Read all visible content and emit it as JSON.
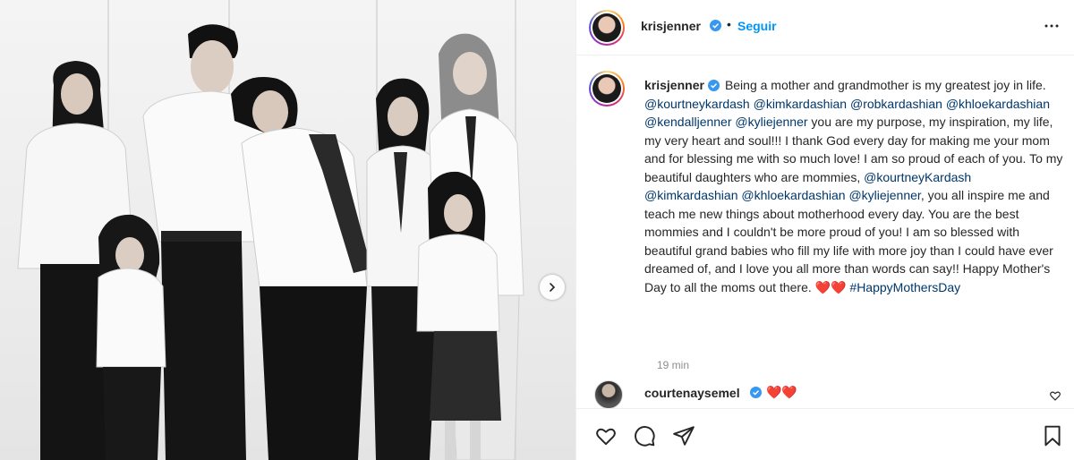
{
  "post": {
    "author": "krisjenner",
    "follow_label": "Seguir",
    "separator": "•",
    "caption": {
      "segments": [
        {
          "t": "Being a mother and grandmother is my greatest joy in life. ",
          "link": false
        },
        {
          "t": "@kourtneykardash",
          "link": true
        },
        {
          "t": " ",
          "link": false
        },
        {
          "t": "@kimkardashian",
          "link": true
        },
        {
          "t": " ",
          "link": false
        },
        {
          "t": "@robkardashian",
          "link": true
        },
        {
          "t": " ",
          "link": false
        },
        {
          "t": "@khloekardashian",
          "link": true
        },
        {
          "t": " ",
          "link": false
        },
        {
          "t": "@kendalljenner",
          "link": true
        },
        {
          "t": " ",
          "link": false
        },
        {
          "t": "@kyliejenner",
          "link": true
        },
        {
          "t": " you are my purpose, my inspiration, my life, my very heart and soul!!! I thank God every day for making me your mom and for blessing me with so much love! I am so proud of each of you. To my beautiful daughters who are mommies, ",
          "link": false
        },
        {
          "t": "@kourtneyKardash",
          "link": true
        },
        {
          "t": " ",
          "link": false
        },
        {
          "t": "@kimkardashian",
          "link": true
        },
        {
          "t": " ",
          "link": false
        },
        {
          "t": "@khloekardashian",
          "link": true
        },
        {
          "t": " ",
          "link": false
        },
        {
          "t": "@kyliejenner",
          "link": true
        },
        {
          "t": ", you all inspire me and teach me new things about motherhood every day. You are the best mommies and I couldn't be more proud of you! I am so blessed with beautiful grand babies who fill my life with more joy than I could have ever dreamed of, and I love you all more than words can say!! Happy Mother's Day to all the moms out there. ",
          "link": false
        },
        {
          "t": "❤️❤️",
          "link": false,
          "emoji": true
        },
        {
          "t": " ",
          "link": false
        },
        {
          "t": "#HappyMothersDay",
          "link": true
        }
      ]
    },
    "time_ago": "19 min"
  },
  "comments": [
    {
      "username": "courtenaysemel",
      "text": "❤️❤️"
    }
  ],
  "icons": {
    "verified": "verified-badge-icon",
    "more": "more-options-icon",
    "next": "chevron-right-icon",
    "like": "heart-icon",
    "comment": "comment-bubble-icon",
    "share": "paper-plane-icon",
    "save": "bookmark-icon"
  },
  "colors": {
    "link": "#00376b",
    "follow": "#0095f6",
    "verified": "#3897f0",
    "muted": "#8e8e8e",
    "heart": "#ed4956"
  }
}
